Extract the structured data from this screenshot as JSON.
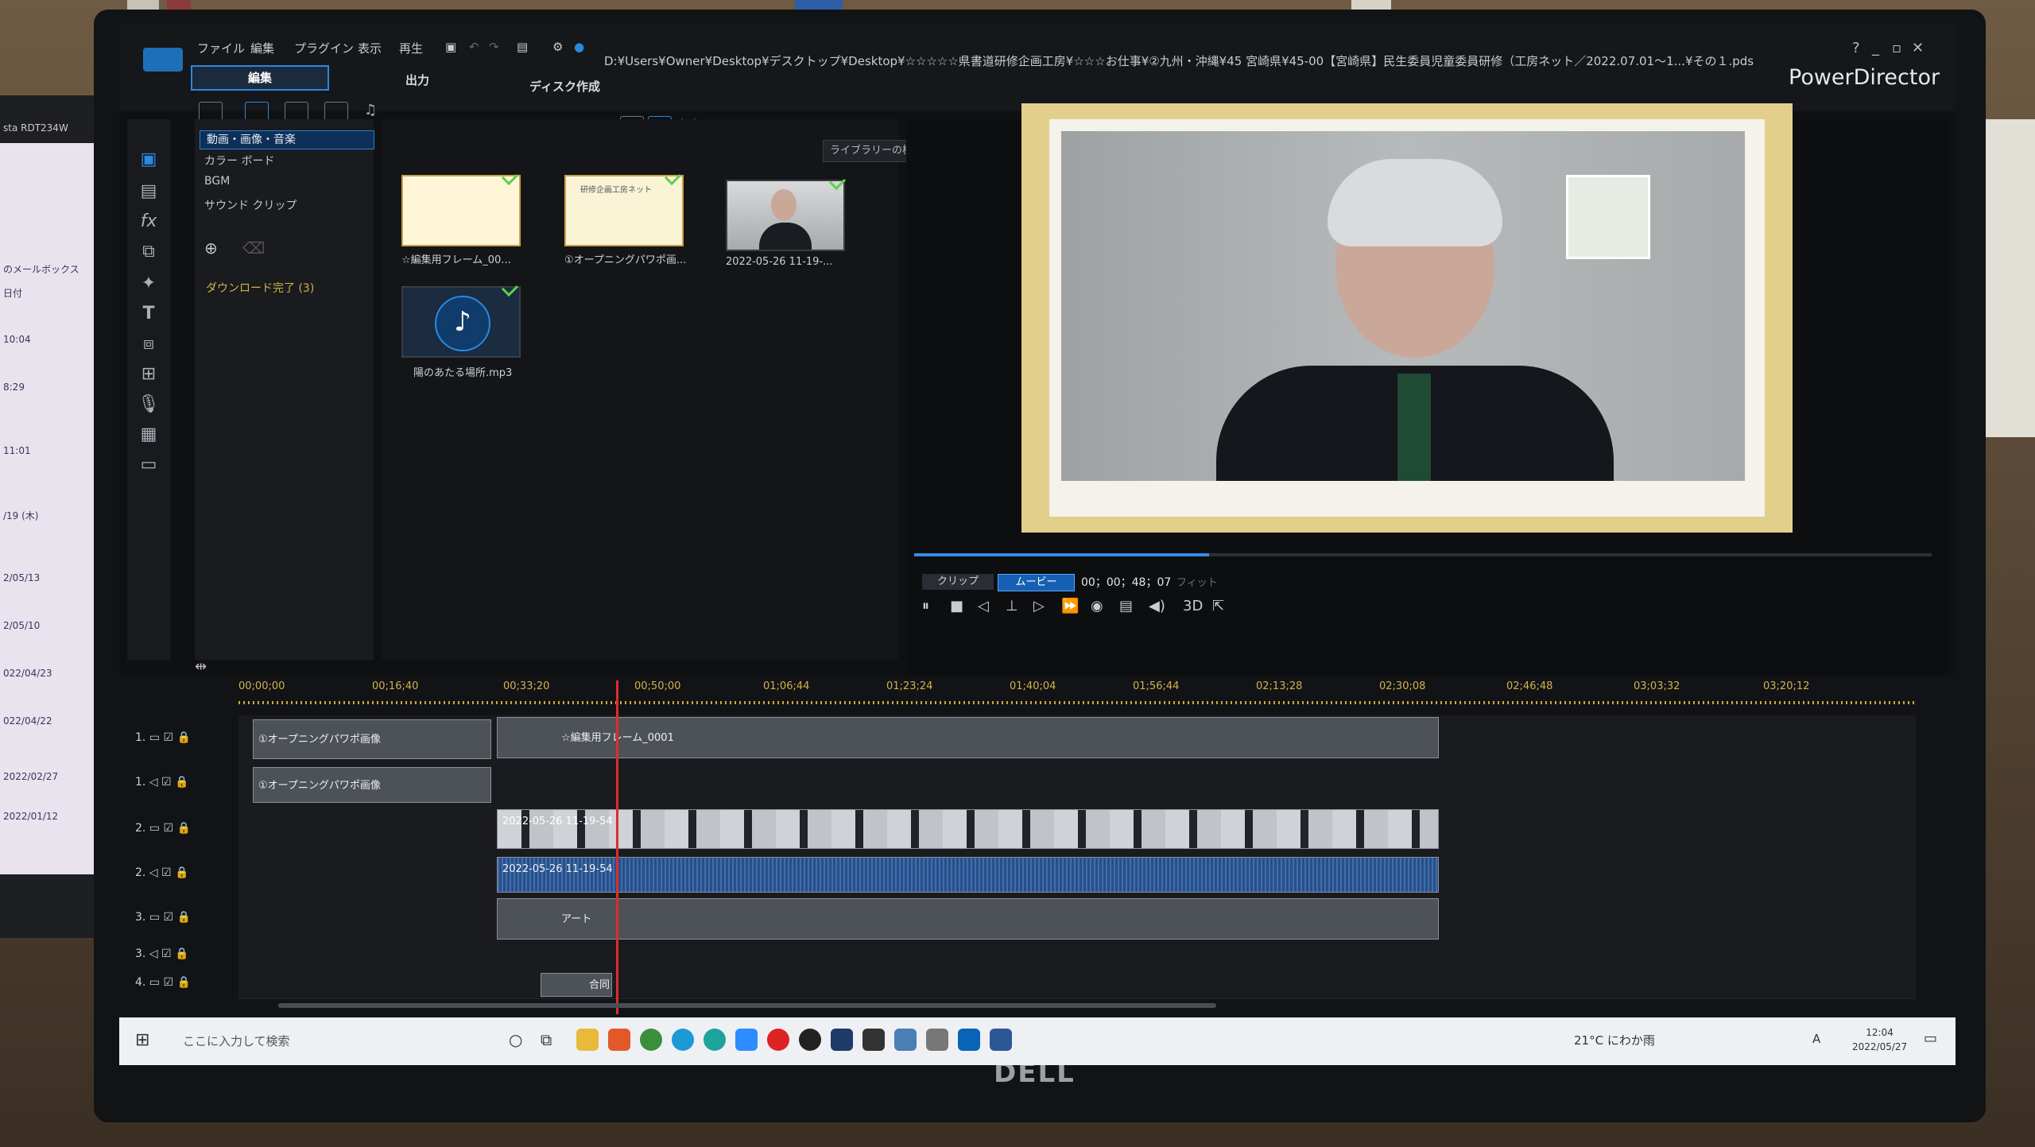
{
  "app": {
    "menu": [
      "ファイル",
      "編集",
      "プラグイン",
      "表示",
      "再生"
    ],
    "title_path": "D:¥Users¥Owner¥Desktop¥デスクトップ¥Desktop¥☆☆☆☆☆県書道研修企画工房¥☆☆☆お仕事¥②九州・沖縄¥45 宮崎県¥45-00【宮崎県】民生委員児童委員研修（工房ネット／2022.07.01～1...¥その１.pds",
    "brand": "PowerDirector",
    "window_controls": [
      "?",
      "_",
      "▫",
      "✕"
    ]
  },
  "modes": {
    "edit": "編集",
    "output": "出力",
    "disc": "ディスク作成"
  },
  "categories": {
    "active": "動画・画像・音楽",
    "items": [
      "カラー ボード",
      "BGM",
      "サウンド クリップ"
    ],
    "download": "ダウンロード完了 (3)"
  },
  "library": {
    "search_placeholder": "ライブラリーの検索",
    "items": [
      {
        "label": "☆編集用フレーム_00..."
      },
      {
        "label": "①オープニングパワポ画...",
        "thumb_text": "研修企画工房ネット"
      },
      {
        "label": "2022-05-26 11-19-..."
      },
      {
        "label": "陽のあたる場所.mp3"
      }
    ]
  },
  "preview": {
    "clip_label": "クリップ",
    "movie_label": "ムービー",
    "timecode": "00；00；48；07",
    "fit_label": "フィット",
    "three_d": "3D",
    "progress": 0.29
  },
  "timeline": {
    "ticks": [
      "00;00;00",
      "00;16;40",
      "00;33;20",
      "00;50;00",
      "01;06;44",
      "01;23;24",
      "01;40;04",
      "01;56;44",
      "02;13;28",
      "02;30;08",
      "02;46;48",
      "03;03;32",
      "03;20;12"
    ],
    "tracks": [
      {
        "label": "1."
      },
      {
        "label": "1."
      },
      {
        "label": "2."
      },
      {
        "label": "2."
      },
      {
        "label": "3."
      },
      {
        "label": "3."
      },
      {
        "label": "4."
      }
    ],
    "clips": {
      "opening_video": "①オープニングパワポ画像",
      "opening_audio": "①オープニングパワポ画像",
      "frame": "☆編集用フレーム_0001",
      "video_main": "2022-05-26 11-19-54",
      "audio_main": "2022-05-26 11-19-54",
      "art": "アート",
      "caption": "合同"
    }
  },
  "taskbar": {
    "search_placeholder": "ここに入力して検索",
    "weather": "21°C にわか雨",
    "ime": "A",
    "time": "12:04",
    "date": "2022/05/27"
  },
  "left_monitor": {
    "lines": [
      "sta RDT234W",
      "のメールボックス",
      "日付",
      "10:04",
      "8:29",
      "11:01",
      "/19 (木)",
      "2/05/13",
      "2/05/10",
      "022/04/23",
      "022/04/22",
      "2022/02/27",
      "2022/01/12"
    ]
  },
  "bezel": {
    "logo": "DELL"
  }
}
